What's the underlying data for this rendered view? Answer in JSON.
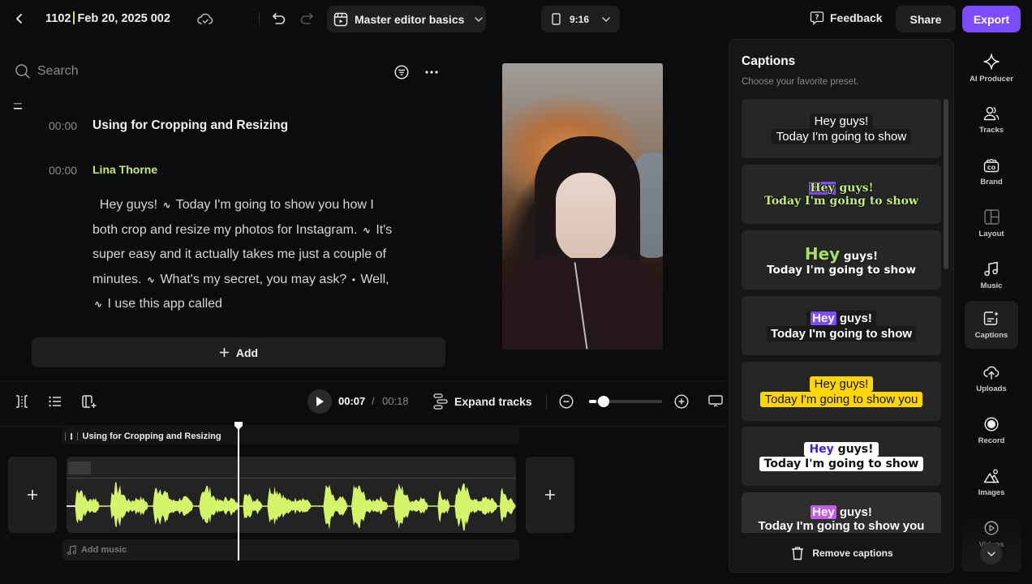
{
  "header": {
    "project_number": "1102",
    "project_name": "Feb 20, 2025 002",
    "template_name": "Master editor basics",
    "aspect_ratio": "9:16",
    "feedback_label": "Feedback",
    "share_label": "Share",
    "export_label": "Export",
    "icons": [
      "back-icon",
      "cloud-saved-icon",
      "undo-icon",
      "redo-icon",
      "template-icon",
      "phone-aspect-icon",
      "feedback-icon"
    ]
  },
  "script": {
    "search_placeholder": "Search",
    "scene": {
      "time": "00:00",
      "title": "Using for Cropping and Resizing"
    },
    "speaker": {
      "time": "00:00",
      "name": "Lina Thorne"
    },
    "transcript": [
      {
        "text": "Hey guys!",
        "pause": "pause-wave"
      },
      {
        "text": "Today I'm going to show you how I both crop and resize my photos for Instagram.",
        "pause": "pause-wave"
      },
      {
        "text": "It's super easy and it actually takes me just a couple of minutes.",
        "pause": "pause-wave"
      },
      {
        "text": "What's my secret, you may ask?",
        "pause": "dot"
      },
      {
        "text": "Well,",
        "pause": "pause-wave"
      },
      {
        "text": "I use this app called",
        "pause": null
      }
    ],
    "add_label": "Add"
  },
  "timeline": {
    "current_time": "00:07",
    "time_separator": "/",
    "total_time": "00:18",
    "expand_label": "Expand tracks",
    "zoom_level": 0.1,
    "scene_track_label": "Using for Cropping and Resizing",
    "add_music_label": "Add music",
    "playhead_fraction": 0.39
  },
  "captions": {
    "title": "Captions",
    "subtitle": "Choose your favorite preset.",
    "presets": [
      {
        "line1": "Hey guys!",
        "highlight": "",
        "line1_rest": "",
        "line2": "Today I'm going to show"
      },
      {
        "line1": "",
        "highlight": "Hey",
        "line1_rest": " guys!",
        "line2": "Today I'm going to show"
      },
      {
        "line1": "",
        "highlight": "Hey",
        "line1_rest": " guys!",
        "line2": "Today I'm going to show"
      },
      {
        "line1": "",
        "highlight": "Hey",
        "line1_rest": " guys!",
        "line2": "Today I'm going to show"
      },
      {
        "line1": "Hey guys!",
        "highlight": "",
        "line1_rest": "",
        "line2": "Today I'm going to show you"
      },
      {
        "line1": "",
        "highlight": "Hey",
        "line1_rest": " guys!",
        "line2": "Today I'm going to show"
      },
      {
        "line1": "",
        "highlight": "Hey",
        "line1_rest": " guys!",
        "line2": "Today I'm going to show you"
      }
    ],
    "remove_label": "Remove captions"
  },
  "rail": {
    "items": [
      {
        "label": "AI Producer",
        "icon": "sparkle-icon"
      },
      {
        "label": "Tracks",
        "icon": "people-icon"
      },
      {
        "label": "Brand",
        "icon": "brand-kit-icon"
      },
      {
        "label": "Layout",
        "icon": "layout-icon"
      },
      {
        "label": "Music",
        "icon": "music-note-icon"
      },
      {
        "label": "Captions",
        "icon": "captions-icon",
        "active": true
      },
      {
        "label": "Uploads",
        "icon": "cloud-upload-icon"
      },
      {
        "label": "Record",
        "icon": "record-icon"
      },
      {
        "label": "Images",
        "icon": "image-icon"
      },
      {
        "label": "Videos",
        "icon": "play-circle-icon"
      }
    ]
  },
  "colors": {
    "accent": "#7c4dff",
    "speaker": "#c5ec6b",
    "waveform": "#d4f56a"
  }
}
